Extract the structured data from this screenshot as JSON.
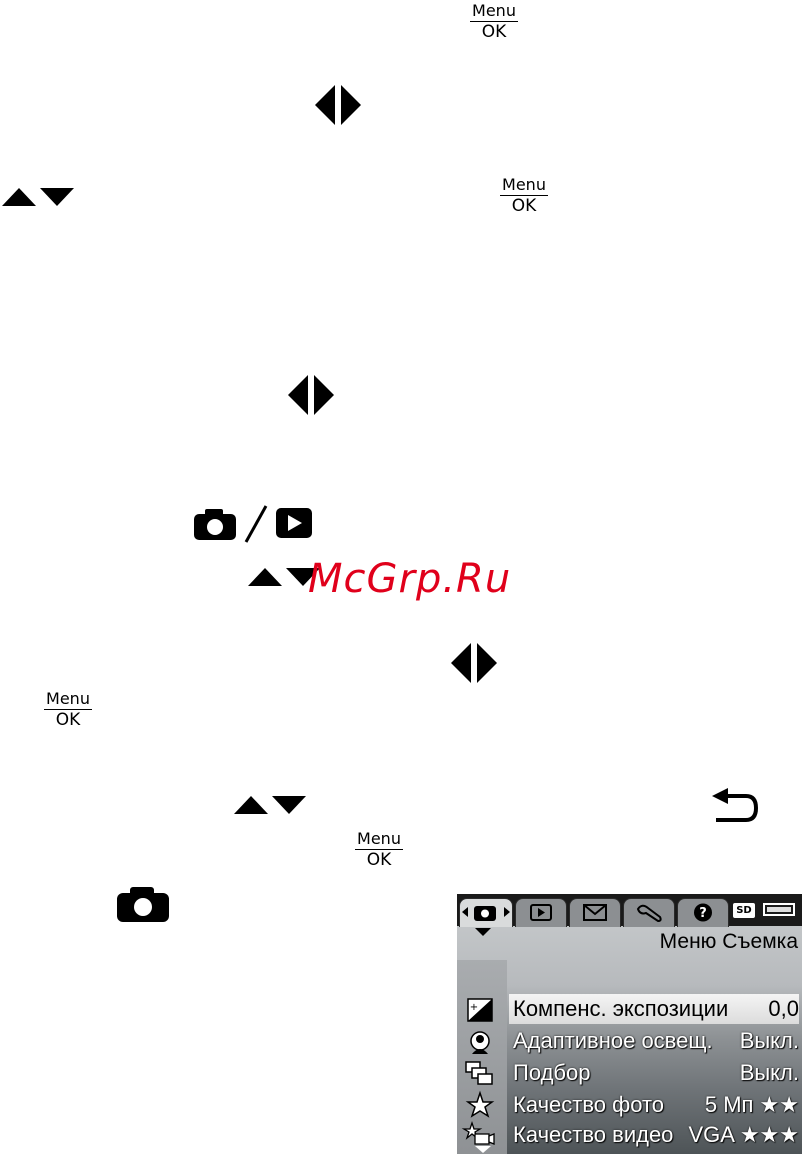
{
  "buttons": {
    "menu_top": "Menu",
    "menu_bottom": "OK"
  },
  "watermark": "McGrp.Ru",
  "camera_screen": {
    "menu_title": "Меню Съемка",
    "storage_badge": "SD",
    "items": [
      {
        "label": "Компенс. экспозиции",
        "value": "0,0"
      },
      {
        "label": "Адаптивное освещ.",
        "value": "Выкл."
      },
      {
        "label": "Подбор",
        "value": "Выкл."
      },
      {
        "label": "Качество фото",
        "value": "5 Мп ★★"
      },
      {
        "label": "Качество видео",
        "value": "VGA ★★★"
      }
    ]
  }
}
